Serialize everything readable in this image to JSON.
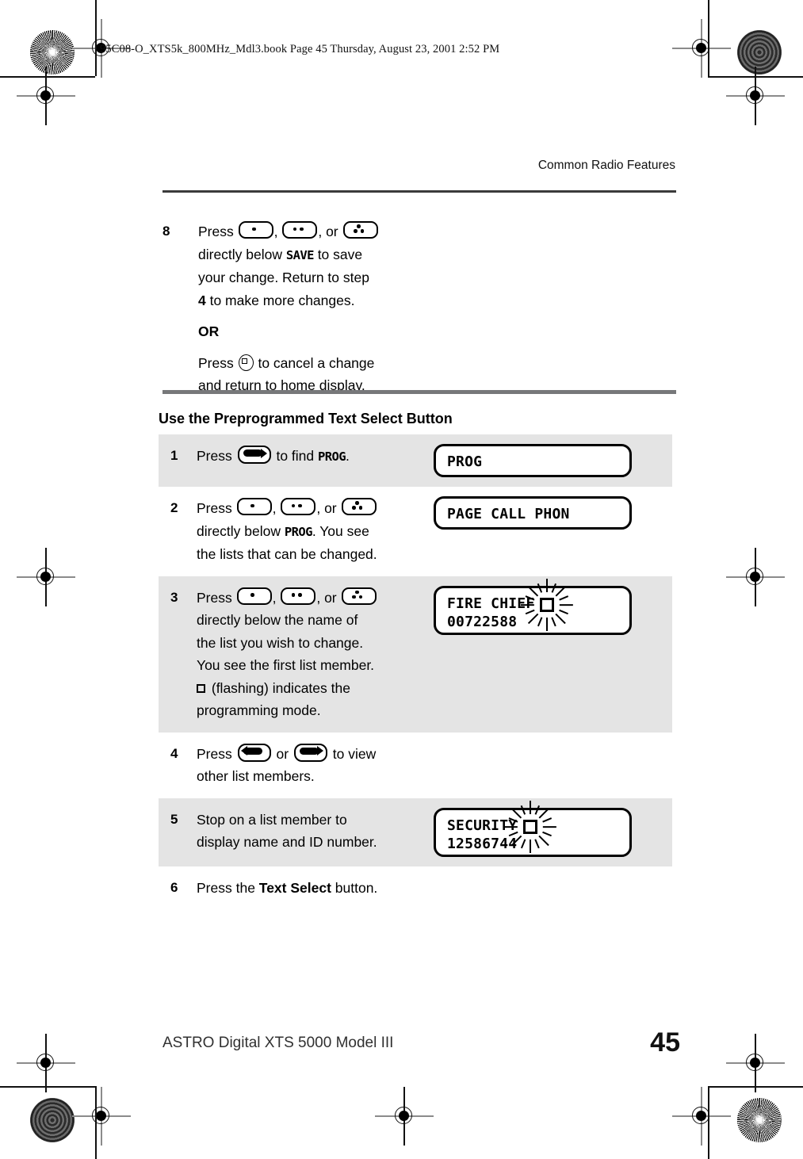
{
  "filestamp": "95C08-O_XTS5k_800MHz_Mdl3.book  Page 45  Thursday, August 23, 2001  2:52 PM",
  "running_head": "Common Radio Features",
  "step8": {
    "number": "8",
    "press_label": "Press ",
    "sep_comma": ", ",
    "sep_or": ", or ",
    "line2_a": "directly below ",
    "line2_lcd": "SAVE",
    "line2_b": " to save",
    "line3": "your change. Return to step",
    "line4_num": "4",
    "line4_rest": " to make more changes.",
    "or_label": "OR",
    "cancel_a": "Press ",
    "cancel_b": " to cancel a change",
    "cancel_c": "and return to home display."
  },
  "section": {
    "heading": "Use the Preprogrammed Text Select Button"
  },
  "steps": [
    {
      "number": "1",
      "shaded": true,
      "text_parts": {
        "a": "Press ",
        "b": " to find ",
        "lcd": "PROG",
        "c": "."
      },
      "display": {
        "lines": [
          "PROG"
        ],
        "flashing": false
      }
    },
    {
      "number": "2",
      "shaded": false,
      "text_parts": {
        "a": "Press ",
        "b": "directly below ",
        "lcd": "PROG",
        "c": ". You see",
        "d": "the lists that can be changed."
      },
      "display": {
        "lines": [
          "PAGE CALL PHON"
        ],
        "flashing": false
      }
    },
    {
      "number": "3",
      "shaded": true,
      "text_parts": {
        "a": "Press ",
        "b": "directly below the name of",
        "c": "the list you wish to change.",
        "d": "You see the first list member.",
        "e": " (flashing) indicates the",
        "f": "programming mode."
      },
      "display": {
        "lines": [
          "FIRE CHIEF",
          "00722588"
        ],
        "flashing": true
      }
    },
    {
      "number": "4",
      "shaded": false,
      "text_parts": {
        "a": "Press ",
        "b": " or ",
        "c": " to view",
        "d": "other list members."
      },
      "display": null
    },
    {
      "number": "5",
      "shaded": true,
      "text_parts": {
        "a": "Stop on a list member to",
        "b": "display name and ID number."
      },
      "display": {
        "lines": [
          "SECURITY",
          "12586744"
        ],
        "flashing": true
      }
    },
    {
      "number": "6",
      "shaded": false,
      "text_parts": {
        "a": "Press the ",
        "bold": "Text Select",
        "b": " button."
      },
      "display": null
    }
  ],
  "footer": {
    "title": "ASTRO Digital XTS 5000 Model III",
    "page_number": "45"
  }
}
